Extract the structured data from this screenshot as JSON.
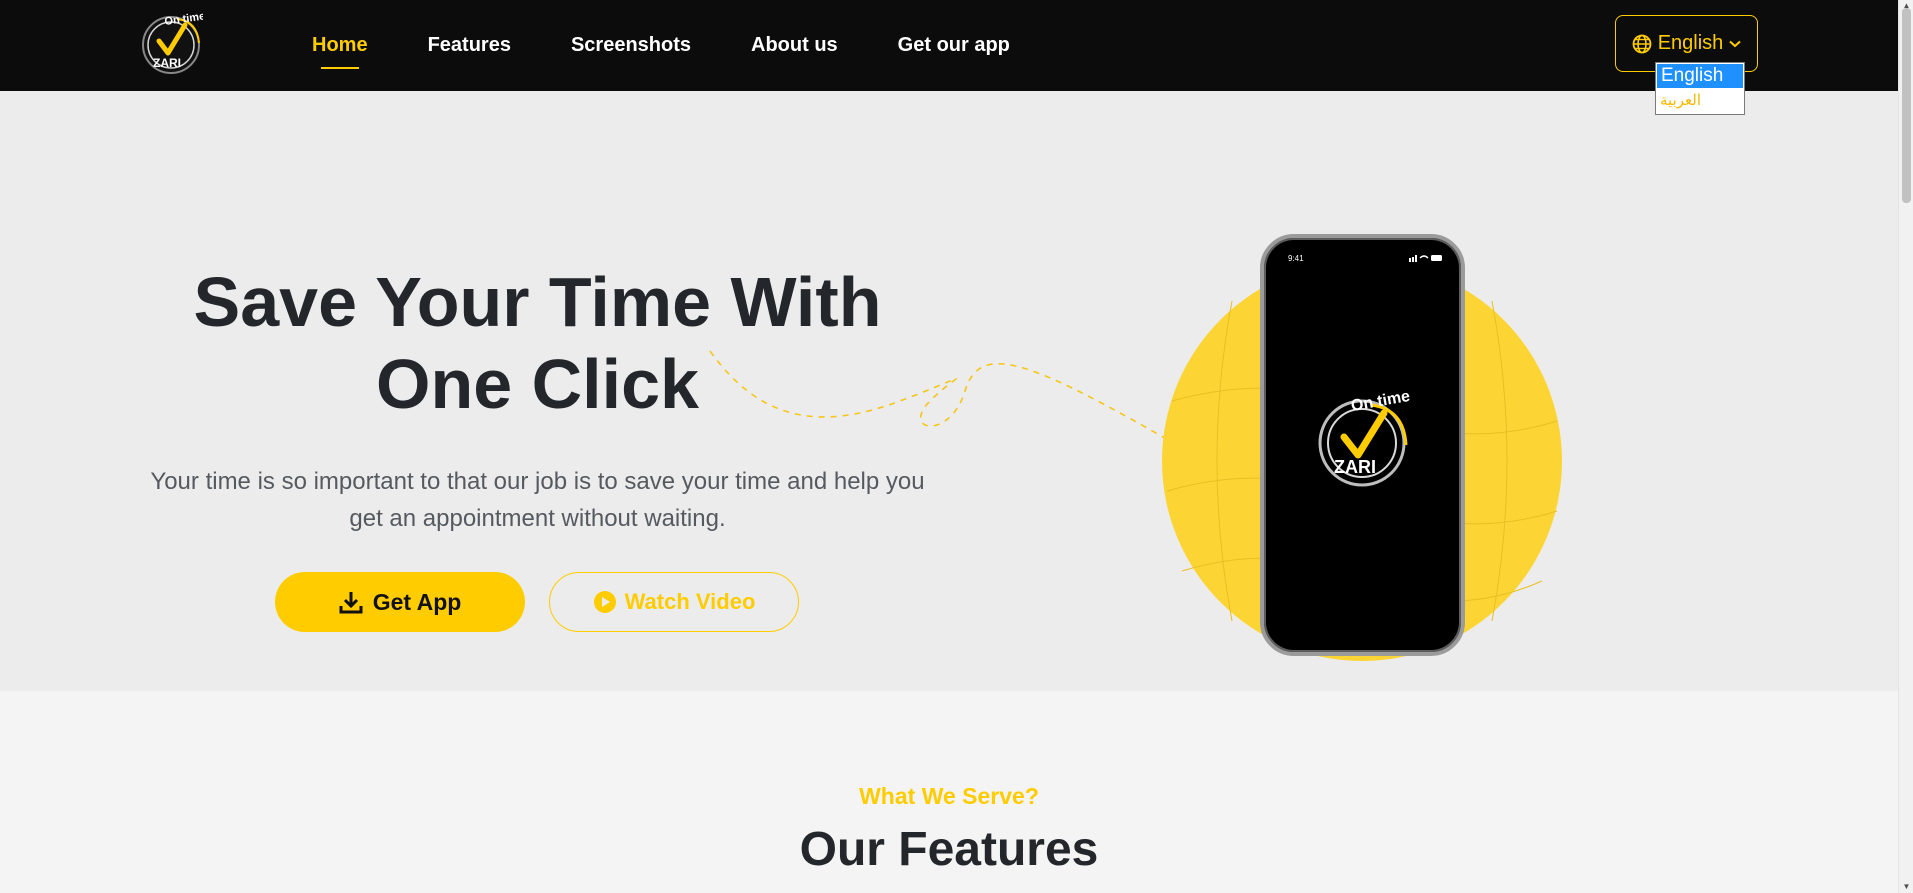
{
  "nav": {
    "logo_text": {
      "line1": "On time",
      "line2": "ZARI"
    },
    "links": [
      {
        "label": "Home",
        "active": true
      },
      {
        "label": "Features",
        "active": false
      },
      {
        "label": "Screenshots",
        "active": false
      },
      {
        "label": "About us",
        "active": false
      },
      {
        "label": "Get our app",
        "active": false
      }
    ],
    "language": {
      "selected": "English",
      "options": [
        "English",
        "العربية"
      ],
      "icon": "globe-icon"
    }
  },
  "hero": {
    "title": "Save Your Time With One Click",
    "subtitle": "Your time is so important to that our job is to save your time and help you get an appointment without waiting.",
    "get_app_label": "Get App",
    "watch_video_label": "Watch Video",
    "phone": {
      "time": "9:41",
      "logo_line1": "On time",
      "logo_line2": "ZARI"
    }
  },
  "features": {
    "kicker": "What We Serve?",
    "title": "Our Features"
  },
  "colors": {
    "accent": "#ffcc00",
    "navbar_bg": "#0c0c0c",
    "hero_bg": "#ececec",
    "text_dark": "#23262b"
  }
}
